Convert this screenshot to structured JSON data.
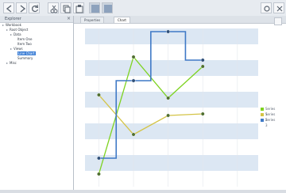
{
  "toolbar": {
    "buttons": [
      "back-icon",
      "forward-icon",
      "refresh-icon",
      "cut-icon",
      "copy-icon",
      "paste-icon",
      "grid-icon",
      "table-icon"
    ],
    "right_buttons": [
      "gear-icon",
      "close-icon"
    ]
  },
  "left_panel": {
    "title": "Explorer",
    "tree": [
      {
        "label": "Workbook",
        "indent": 0,
        "selected": false
      },
      {
        "label": "Root Object",
        "indent": 1,
        "selected": false
      },
      {
        "label": "Data",
        "indent": 2,
        "selected": false
      },
      {
        "label": "Item One",
        "indent": 3,
        "selected": false
      },
      {
        "label": "Item Two",
        "indent": 3,
        "selected": false
      },
      {
        "label": "Views",
        "indent": 2,
        "selected": false
      },
      {
        "label": "Line Chart",
        "indent": 3,
        "selected": true
      },
      {
        "label": "Summary",
        "indent": 3,
        "selected": false
      },
      {
        "label": "Misc",
        "indent": 1,
        "selected": false
      }
    ]
  },
  "tabs": [
    {
      "label": "Properties",
      "active": false
    },
    {
      "label": "Chart",
      "active": true
    }
  ],
  "chart_data": {
    "type": "line",
    "x": [
      1,
      2,
      3,
      4,
      5
    ],
    "ylim": [
      0,
      100
    ],
    "band_colors": [
      "#dce7f3",
      "#ffffff"
    ],
    "series": [
      {
        "name": "Series 1",
        "color": "#7ed321",
        "values": [
          8,
          82,
          56,
          76,
          null
        ]
      },
      {
        "name": "Series 2",
        "color": "#d4c447",
        "values": [
          58,
          33,
          45,
          46,
          null
        ]
      },
      {
        "name": "Series 3",
        "color": "#3f79c6",
        "step": true,
        "values": [
          18,
          67,
          98,
          80,
          null
        ]
      }
    ],
    "legend": [
      "Series 1",
      "Series 2",
      "Series 3"
    ]
  }
}
